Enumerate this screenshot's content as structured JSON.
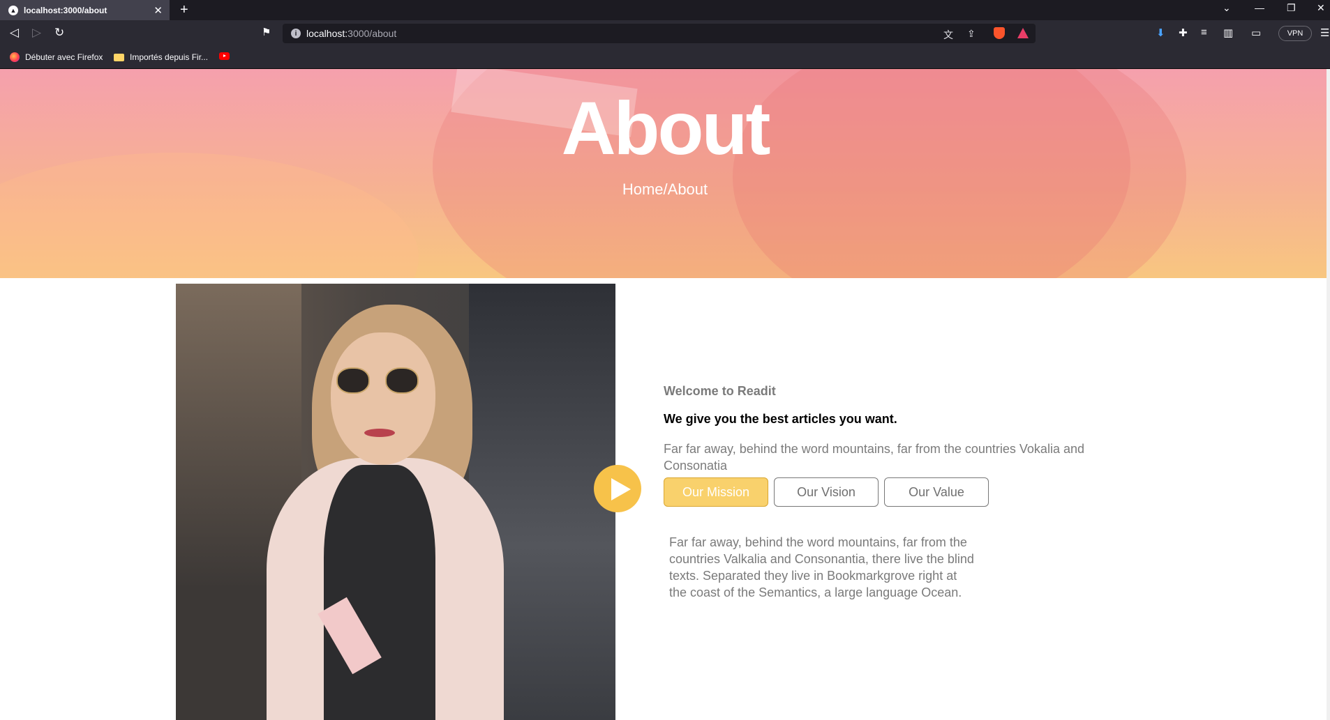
{
  "browser": {
    "tab_title": "localhost:3000/about",
    "url_host": "localhost:",
    "url_path": "3000/about",
    "vpn_label": "VPN",
    "bookmarks": [
      {
        "label": "Débuter avec Firefox",
        "icon": "firefox-icon"
      },
      {
        "label": "Importés depuis Fir...",
        "icon": "folder-icon"
      },
      {
        "label": "",
        "icon": "youtube-icon"
      }
    ]
  },
  "hero": {
    "title": "About",
    "breadcrumb": "Home/About"
  },
  "about": {
    "subheading": "Welcome to Readit",
    "heading": "We give you the best articles you want.",
    "intro": "Far far away, behind the word mountains, far from the countries Vokalia and Consonatia",
    "tabs": [
      {
        "label": "Our Mission",
        "active": true
      },
      {
        "label": "Our Vision",
        "active": false
      },
      {
        "label": "Our Value",
        "active": false
      }
    ],
    "tab_content": "Far far away, behind the word mountains, far from the countries Valkalia and Consonantia, there live the blind texts. Separated they live in Bookmarkgrove right at the coast of the Semantics, a large language Ocean."
  },
  "colors": {
    "accent": "#f7c24a",
    "active_tab": "#f9d16c",
    "hero_top": "#f5a0ad",
    "hero_bottom": "#f8c680"
  }
}
